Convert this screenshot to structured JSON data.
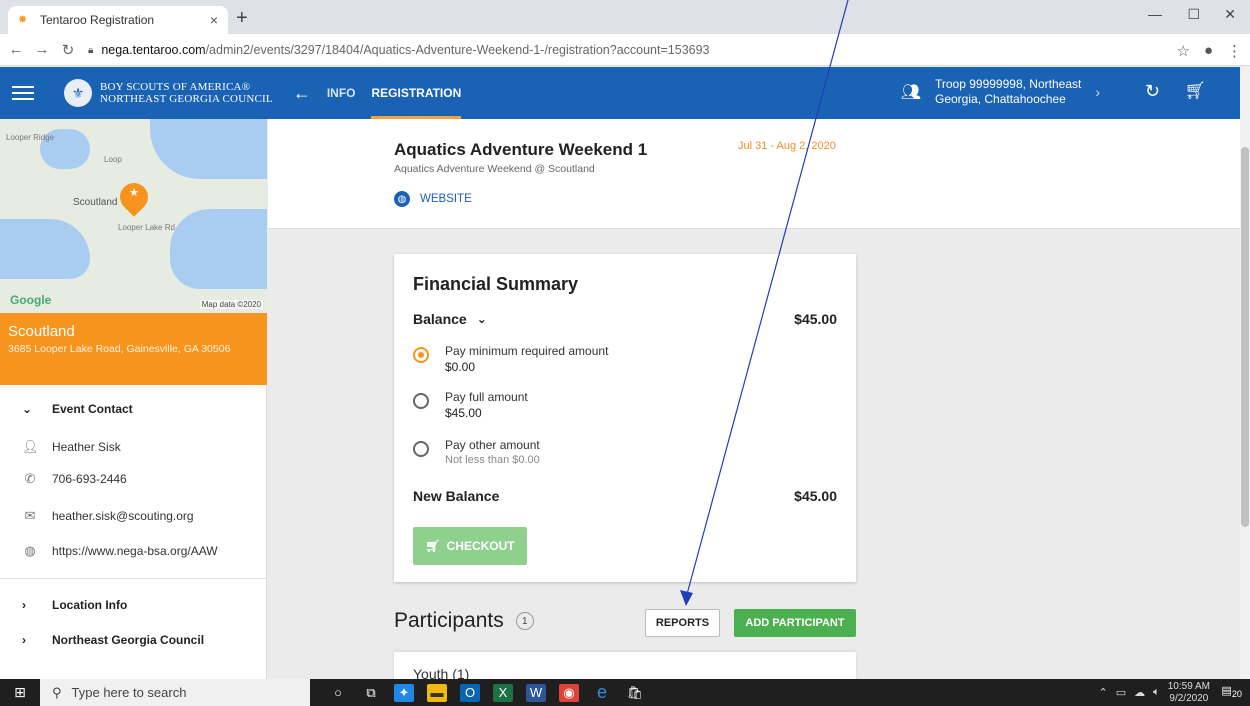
{
  "browser": {
    "tab_title": "Tentaroo Registration",
    "tab_close": "×",
    "new_tab": "+",
    "url_host": "nega.tentaroo.com",
    "url_path": "/admin2/events/3297/18404/Aquatics-Adventure-Weekend-1-/registration?account=153693"
  },
  "appbar": {
    "org_line1": "BOY SCOUTS OF AMERICA®",
    "org_line2": "NORTHEAST GEORGIA COUNCIL",
    "nav_info": "INFO",
    "nav_registration": "REGISTRATION",
    "troop_line1": "Troop 99999998, Northeast",
    "troop_line2": "Georgia, Chattahoochee",
    "brand_color": "#1a62b3"
  },
  "sidebar": {
    "map_place": "Scoutland",
    "map_road1": "Looper Ridge",
    "map_road2": "Loop",
    "map_road3": "Looper Lake Rd",
    "map_logo": "Google",
    "map_data": "Map data ©2020",
    "location_name": "Scoutland",
    "location_address": "3685 Looper Lake Road, Gainesville, GA 30506",
    "event_contact_label": "Event Contact",
    "contact_name": "Heather Sisk",
    "contact_phone": "706-693-2446",
    "contact_email": "heather.sisk@scouting.org",
    "contact_website": "https://www.nega-bsa.org/AAW",
    "location_info_label": "Location Info",
    "council_label": "Northeast Georgia Council",
    "accent_color": "#f7941d"
  },
  "event": {
    "title": "Aquatics Adventure Weekend 1",
    "subtitle": "Aquatics Adventure Weekend @ Scoutland",
    "website_label": "WEBSITE",
    "dates": "Jul 31 - Aug 2, 2020"
  },
  "financial": {
    "title": "Financial Summary",
    "balance_label": "Balance",
    "balance_amount": "$45.00",
    "options": [
      {
        "label": "Pay minimum required amount",
        "value": "$0.00",
        "checked": true
      },
      {
        "label": "Pay full amount",
        "value": "$45.00",
        "checked": false
      },
      {
        "label": "Pay other amount",
        "hint": "Not less than $0.00",
        "checked": false
      }
    ],
    "new_balance_label": "New Balance",
    "new_balance_amount": "$45.00",
    "checkout_label": "CHECKOUT"
  },
  "participants": {
    "title": "Participants",
    "count": "1",
    "reports_label": "REPORTS",
    "add_label": "ADD PARTICIPANT",
    "youth_label": "Youth (1)"
  },
  "taskbar": {
    "search_placeholder": "Type here to search",
    "time": "10:59 AM",
    "date": "9/2/2020",
    "notifications": "20"
  }
}
